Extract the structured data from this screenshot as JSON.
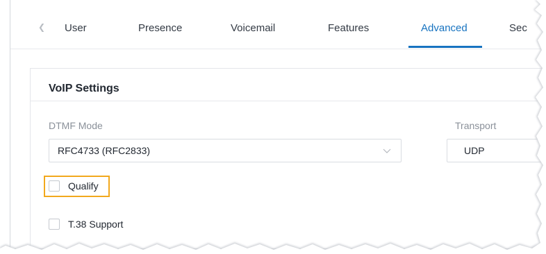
{
  "tabs": {
    "prev_icon": "chevron-left-icon",
    "items": [
      {
        "label": "User"
      },
      {
        "label": "Presence"
      },
      {
        "label": "Voicemail"
      },
      {
        "label": "Features"
      },
      {
        "label": "Advanced",
        "active": true
      },
      {
        "label": "Sec"
      }
    ]
  },
  "section": {
    "title": "VoIP Settings"
  },
  "dtmf_mode": {
    "label": "DTMF Mode",
    "value": "RFC4733 (RFC2833)",
    "chevron_icon": "chevron-down-icon"
  },
  "transport": {
    "label": "Transport",
    "value": "UDP"
  },
  "checkboxes": {
    "qualify": {
      "label": "Qualify",
      "checked": false,
      "highlighted": true
    },
    "t38": {
      "label": "T.38 Support",
      "checked": false
    }
  },
  "colors": {
    "accent": "#1773c0",
    "highlight": "#f2a81d",
    "text": "#222831",
    "muted": "#8a9099"
  }
}
